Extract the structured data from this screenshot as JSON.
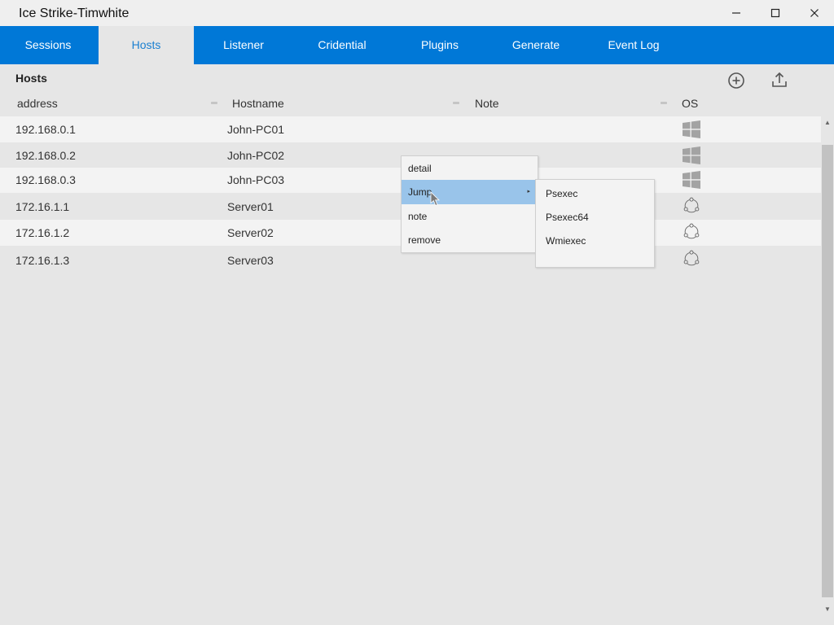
{
  "window": {
    "title": "Ice Strike-Timwhite",
    "controls": [
      "minimize",
      "maximize",
      "close"
    ]
  },
  "tabs": [
    {
      "label": "Sessions",
      "active": false
    },
    {
      "label": "Hosts",
      "active": true
    },
    {
      "label": "Listener",
      "active": false
    },
    {
      "label": "Cridential",
      "active": false
    },
    {
      "label": "Plugins",
      "active": false
    },
    {
      "label": "Generate",
      "active": false
    },
    {
      "label": "Event Log",
      "active": false
    }
  ],
  "hosts": {
    "title": "Hosts",
    "toolbar": {
      "add_icon": "plus-circle-icon",
      "export_icon": "upload-icon"
    },
    "columns": [
      "address",
      "Hostname",
      "Note",
      "OS"
    ],
    "rows": [
      {
        "address": "192.168.0.1",
        "hostname": "John-PC01",
        "note": "",
        "os": "windows"
      },
      {
        "address": "192.168.0.2",
        "hostname": "John-PC02",
        "note": "",
        "os": "windows"
      },
      {
        "address": "192.168.0.3",
        "hostname": "John-PC03",
        "note": "",
        "os": "windows"
      },
      {
        "address": "172.16.1.1",
        "hostname": "Server01",
        "note": "",
        "os": "linux"
      },
      {
        "address": "172.16.1.2",
        "hostname": "Server02",
        "note": "",
        "os": "linux"
      },
      {
        "address": "172.16.1.3",
        "hostname": "Server03",
        "note": "",
        "os": "linux"
      }
    ]
  },
  "context_menu": {
    "items": [
      "detail",
      "Jump",
      "note",
      "remove"
    ],
    "highlighted": "Jump",
    "submenu": [
      "Psexec",
      "Psexec64",
      "Wmiexec"
    ]
  },
  "colors": {
    "accent": "#0078d7",
    "active_tab_text": "#1a7fd0",
    "background": "#e6e6e6",
    "row_alt": "#f3f3f3",
    "menu_highlight": "#99c4ea"
  }
}
